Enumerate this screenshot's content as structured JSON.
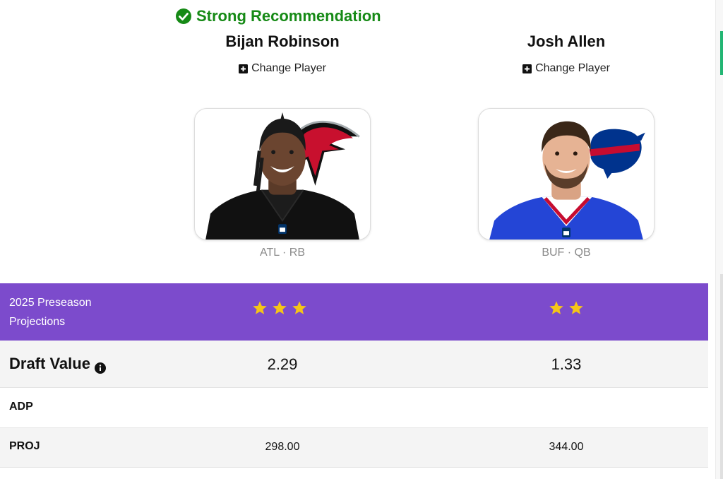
{
  "recommendation": {
    "text": "Strong Recommendation",
    "icon": "check-circle-icon",
    "color": "#168a16"
  },
  "players": [
    {
      "name": "Bijan Robinson",
      "change_label": "Change Player",
      "team_pos": "ATL · RB",
      "stars": 3
    },
    {
      "name": "Josh Allen",
      "change_label": "Change Player",
      "team_pos": "BUF · QB",
      "stars": 2
    }
  ],
  "projections_band": {
    "label": "2025 Preseason Projections",
    "color": "#7c4bcc",
    "star_color": "#f5c518"
  },
  "rows": {
    "draft_value": {
      "label": "Draft Value",
      "values": [
        "2.29",
        "1.33"
      ]
    },
    "adp": {
      "label": "ADP",
      "values": [
        "",
        ""
      ]
    },
    "proj": {
      "label": "PROJ",
      "values": [
        "298.00",
        "344.00"
      ]
    }
  }
}
